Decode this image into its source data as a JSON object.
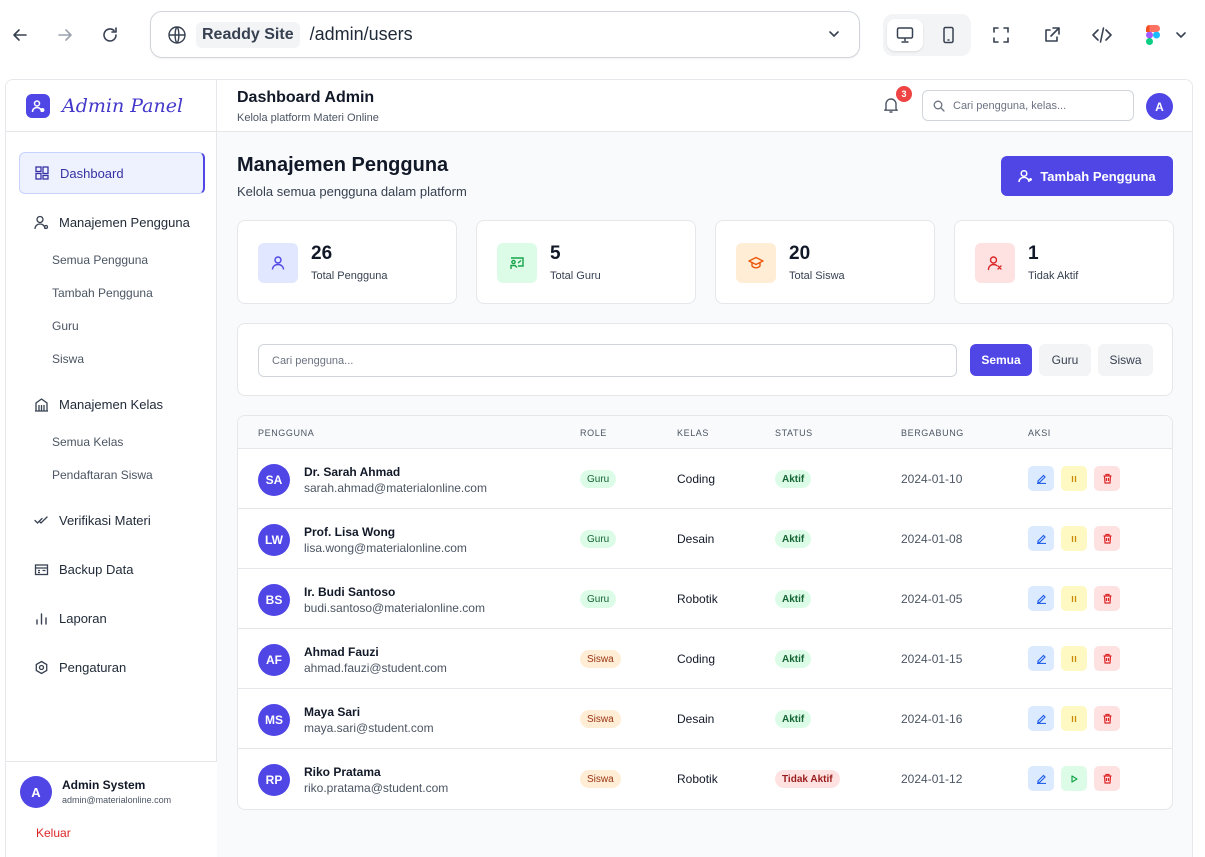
{
  "browser": {
    "site_chip": "Readdy Site",
    "url_path": "/admin/users"
  },
  "sidebar": {
    "brand": "Admin Panel",
    "items": [
      {
        "label": "Dashboard",
        "icon": "grid-icon",
        "active": true
      },
      {
        "label": "Manajemen Pengguna",
        "icon": "users-icon",
        "sub": [
          "Semua Pengguna",
          "Tambah Pengguna",
          "Guru",
          "Siswa"
        ]
      },
      {
        "label": "Manajemen Kelas",
        "icon": "building-icon",
        "sub": [
          "Semua Kelas",
          "Pendaftaran Siswa"
        ]
      },
      {
        "label": "Verifikasi Materi",
        "icon": "check-double-icon"
      },
      {
        "label": "Backup Data",
        "icon": "database-icon"
      },
      {
        "label": "Laporan",
        "icon": "bar-chart-icon"
      },
      {
        "label": "Pengaturan",
        "icon": "settings-icon"
      }
    ],
    "profile": {
      "initial": "A",
      "name": "Admin System",
      "email": "admin@materialonline.com",
      "logout": "Keluar"
    }
  },
  "header": {
    "title": "Dashboard Admin",
    "subtitle": "Kelola platform Materi Online",
    "notif_count": "3",
    "search_placeholder": "Cari pengguna, kelas...",
    "avatar_initial": "A"
  },
  "page": {
    "title": "Manajemen Pengguna",
    "subtitle": "Kelola semua pengguna dalam platform",
    "add_button": "Tambah Pengguna"
  },
  "stats": [
    {
      "value": "26",
      "label": "Total Pengguna",
      "icon": "user-icon",
      "bg": "#e0e7ff",
      "fg": "#4f46e5"
    },
    {
      "value": "5",
      "label": "Total Guru",
      "icon": "teacher-icon",
      "bg": "#dcfce7",
      "fg": "#16a34a"
    },
    {
      "value": "20",
      "label": "Total Siswa",
      "icon": "graduation-cap-icon",
      "bg": "#ffedd5",
      "fg": "#ea580c"
    },
    {
      "value": "1",
      "label": "Tidak Aktif",
      "icon": "user-x-icon",
      "bg": "#fee2e2",
      "fg": "#dc2626"
    }
  ],
  "filter": {
    "placeholder": "Cari pengguna...",
    "chips": [
      "Semua",
      "Guru",
      "Siswa"
    ]
  },
  "table": {
    "headers": [
      "Pengguna",
      "Role",
      "Kelas",
      "Status",
      "Bergabung",
      "Aksi"
    ],
    "rows": [
      {
        "initials": "SA",
        "name": "Dr. Sarah Ahmad",
        "email": "sarah.ahmad@materialonline.com",
        "role": "Guru",
        "kelas": "Coding",
        "status": "Aktif",
        "joined": "2024-01-10"
      },
      {
        "initials": "LW",
        "name": "Prof. Lisa Wong",
        "email": "lisa.wong@materialonline.com",
        "role": "Guru",
        "kelas": "Desain",
        "status": "Aktif",
        "joined": "2024-01-08"
      },
      {
        "initials": "BS",
        "name": "Ir. Budi Santoso",
        "email": "budi.santoso@materialonline.com",
        "role": "Guru",
        "kelas": "Robotik",
        "status": "Aktif",
        "joined": "2024-01-05"
      },
      {
        "initials": "AF",
        "name": "Ahmad Fauzi",
        "email": "ahmad.fauzi@student.com",
        "role": "Siswa",
        "kelas": "Coding",
        "status": "Aktif",
        "joined": "2024-01-15"
      },
      {
        "initials": "MS",
        "name": "Maya Sari",
        "email": "maya.sari@student.com",
        "role": "Siswa",
        "kelas": "Desain",
        "status": "Aktif",
        "joined": "2024-01-16"
      },
      {
        "initials": "RP",
        "name": "Riko Pratama",
        "email": "riko.pratama@student.com",
        "role": "Siswa",
        "kelas": "Robotik",
        "status": "Tidak Aktif",
        "joined": "2024-01-12"
      }
    ]
  },
  "colors": {
    "accent": "#4f46e5",
    "danger": "#dc2626"
  }
}
